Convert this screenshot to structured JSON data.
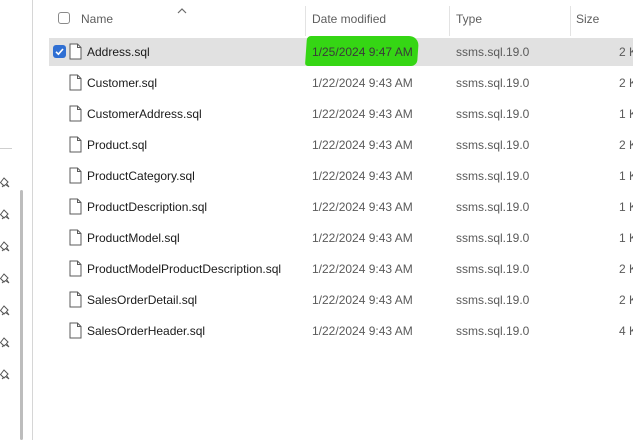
{
  "columns": {
    "name": "Name",
    "date_modified": "Date modified",
    "type": "Type",
    "size": "Size"
  },
  "icons": {
    "sort": "chevron-up-icon",
    "file": "file-icon",
    "pin": "pin-icon",
    "check": "checkmark-icon"
  },
  "colors": {
    "selection_bg": "#e1e1e1",
    "checkbox_accent": "#2f6fd3",
    "highlight_marker": "#35d614"
  },
  "files": [
    {
      "name": "Address.sql",
      "date": "1/25/2024 9:47 AM",
      "type": "ssms.sql.19.0",
      "size": "2 K",
      "selected": true,
      "highlighted": true
    },
    {
      "name": "Customer.sql",
      "date": "1/22/2024 9:43 AM",
      "type": "ssms.sql.19.0",
      "size": "2 K"
    },
    {
      "name": "CustomerAddress.sql",
      "date": "1/22/2024 9:43 AM",
      "type": "ssms.sql.19.0",
      "size": "1 K"
    },
    {
      "name": "Product.sql",
      "date": "1/22/2024 9:43 AM",
      "type": "ssms.sql.19.0",
      "size": "2 K"
    },
    {
      "name": "ProductCategory.sql",
      "date": "1/22/2024 9:43 AM",
      "type": "ssms.sql.19.0",
      "size": "1 K"
    },
    {
      "name": "ProductDescription.sql",
      "date": "1/22/2024 9:43 AM",
      "type": "ssms.sql.19.0",
      "size": "1 K"
    },
    {
      "name": "ProductModel.sql",
      "date": "1/22/2024 9:43 AM",
      "type": "ssms.sql.19.0",
      "size": "1 K"
    },
    {
      "name": "ProductModelProductDescription.sql",
      "date": "1/22/2024 9:43 AM",
      "type": "ssms.sql.19.0",
      "size": "2 K"
    },
    {
      "name": "SalesOrderDetail.sql",
      "date": "1/22/2024 9:43 AM",
      "type": "ssms.sql.19.0",
      "size": "2 K"
    },
    {
      "name": "SalesOrderHeader.sql",
      "date": "1/22/2024 9:43 AM",
      "type": "ssms.sql.19.0",
      "size": "4 K"
    }
  ]
}
